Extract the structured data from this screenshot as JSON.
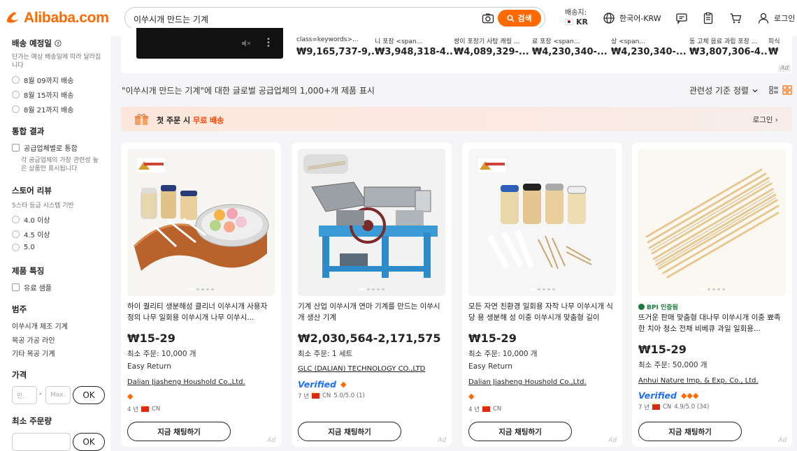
{
  "header": {
    "logo": "Alibaba.com",
    "search_value": "이쑤시개 만드는 기계",
    "search_button": "검색",
    "ship_to_label": "배송지:",
    "ship_to_country": "KR",
    "language": "한국어-KRW",
    "login": "로그인"
  },
  "sidebar": {
    "delivery": {
      "title": "배송 예정일",
      "note": "단가는 예상 배송일에 따라 달라집니다",
      "options": [
        "8월 09까지 배송",
        "8월 15까지 배송",
        "8월 21까지 배송"
      ]
    },
    "merge": {
      "title": "통합 결과",
      "option": "공급업체별로 통합",
      "note": "각 공급업체의 가장 관련성 높은 상품만 표시됩니다"
    },
    "reviews": {
      "title": "스토어 리뷰",
      "note": "5스타 등급 시스템 기반",
      "options": [
        "4.0 이상",
        "4.5 이상",
        "5.0"
      ]
    },
    "features": {
      "title": "제품 특징",
      "option": "유료 샘플"
    },
    "category": {
      "title": "범주",
      "items": [
        "이쑤시개 제조 기계",
        "목공 가공 라인",
        "기타 목공 기계"
      ]
    },
    "price": {
      "title": "가격",
      "min_placeholder": "민.",
      "max_placeholder": "Max.",
      "ok": "OK"
    },
    "moq": {
      "title": "최소 주문량",
      "ok": "OK"
    }
  },
  "strip": {
    "items": [
      {
        "caption": "class=keywords>...",
        "price": "₩9,165,737-9,..."
      },
      {
        "caption": "니 포장 <span...",
        "price": "₩3,948,318-4..."
      },
      {
        "caption": "쌍이 포장기 사탕 캐링 ...",
        "price": "₩4,089,329-..."
      },
      {
        "caption": "료 포장 <span...",
        "price": "₩4,230,340-..."
      },
      {
        "caption": "상 <span...",
        "price": "₩4,230,340-..."
      },
      {
        "caption": "동 고체 음료 과립 포장 ...",
        "price": "₩3,807,306-4..."
      },
      {
        "caption": "피식",
        "price": "₩"
      }
    ],
    "ad_label": "Ad"
  },
  "results_text": "\"이쑤시개 만드는 기계\"에 대한 글로벌 공급업체의 1,000+개 제품 표시",
  "sort_label": "관련성 기준 정렬",
  "promo": {
    "prefix": "첫 주문 시 ",
    "highlight": "무료 배송",
    "login": "로그인"
  },
  "products": [
    {
      "title": "하이 퀄리티 생분해성 클리너 이쑤시개 사용자 정의 나무 일회용 이쑤시개 나무 이쑤시...",
      "price": "₩15-29",
      "moq": "최소 주문: 10,000 개",
      "easy_return": "Easy Return",
      "supplier": "Dalian Jiasheng Houshold Co.,Ltd.",
      "years": "4 년",
      "country": "CN",
      "chat": "지금 채팅하기",
      "ad": "Ad"
    },
    {
      "title": "기계 산업 이쑤시개 연마 기계를 만드는 이쑤시개 생산 기계",
      "price": "₩2,030,564-2,171,575",
      "moq": "최소 주문: 1 세트",
      "supplier": "GLC (DALIAN) TECHNOLOGY CO.,LTD",
      "verified": "Verified",
      "years": "7 년",
      "country": "CN",
      "rating": "5.0/5.0 (1)",
      "chat": "지금 채팅하기",
      "ad": "Ad"
    },
    {
      "title": "모든 자연 친환경 일회용 자작 나무 이쑤시개 식당 용 생분해 성 이중 이쑤시개 맞춤형 길이",
      "price": "₩15-29",
      "moq": "최소 주문: 10,000 개",
      "easy_return": "Easy Return",
      "supplier": "Dalian Jiasheng Houshold Co.,Ltd.",
      "years": "4 년",
      "country": "CN",
      "chat": "지금 채팅하기",
      "ad": "Ad"
    },
    {
      "badge": "BPI 인증됨",
      "title": "뜨거운 판매 맞춤형 대나무 이쑤시개 이중 뾰족한 치아 청소 전채 비베큐 과일 일회용...",
      "price": "₩15-29",
      "moq": "최소 주문: 50,000 개",
      "supplier": "Anhui Nature Imp. & Exp. Co., Ltd.",
      "verified": "Verified",
      "years": "7 년",
      "country": "CN",
      "rating": "4.9/5.0 (34)",
      "chat": "지금 채팅하기",
      "ad": "Ad"
    }
  ],
  "colors": {
    "brand": "#ff6a00",
    "verified": "#1e6ff5",
    "highlight": "#ff4400"
  }
}
